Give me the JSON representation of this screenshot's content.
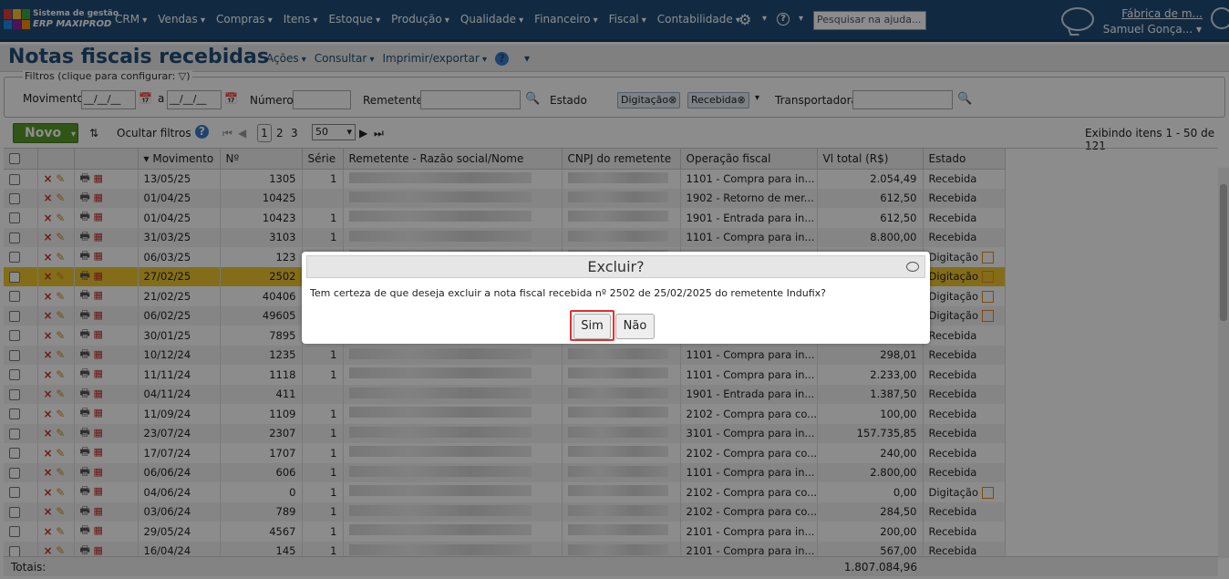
{
  "app": {
    "brand_line1": "Sistema de gestão",
    "brand_line2": "ERP MAXIPROD",
    "logo_colors": [
      "#e53935",
      "#fbc02d",
      "#43a047",
      "#1e88e5",
      "#8e24aa",
      "#fb8c00"
    ]
  },
  "topnav": {
    "items": [
      "CRM",
      "Vendas",
      "Compras",
      "Itens",
      "Estoque",
      "Produção",
      "Qualidade",
      "Financeiro",
      "Fiscal",
      "Contabilidade"
    ],
    "search_placeholder": "Pesquisar na ajuda...",
    "company": "Fábrica de m...",
    "user": "Samuel Gonça..."
  },
  "page": {
    "title": "Notas fiscais recebidas",
    "actions": [
      "Ações",
      "Consultar",
      "Imprimir/exportar"
    ],
    "help": "?"
  },
  "filters": {
    "legend": "Filtros (clique para configurar:",
    "movimento_label": "Movimento",
    "date_placeholder": "__/__/__",
    "a_label": "a",
    "numero_label": "Número",
    "remetente_label": "Remetente",
    "estado_label": "Estado",
    "estado_chips": [
      "Digitação",
      "Recebida"
    ],
    "transportadora_label": "Transportadora"
  },
  "toolbar": {
    "novo": "Novo",
    "ocultar": "Ocultar filtros",
    "pages": [
      "1",
      "2",
      "3"
    ],
    "page_size": "50",
    "exibindo": "Exibindo itens 1 - 50 de 121"
  },
  "table": {
    "headers": [
      "Movimento",
      "Nº",
      "Série",
      "Remetente - Razão social/Nome",
      "CNPJ do remetente",
      "Operação fiscal",
      "Vl total (R$)",
      "Estado"
    ],
    "rows": [
      [
        "13/05/25",
        "1305",
        "1",
        "1101 - Compra para in...",
        "2.054,49",
        "Recebida"
      ],
      [
        "01/04/25",
        "10425",
        "",
        "1902 - Retorno de mer...",
        "612,50",
        "Recebida"
      ],
      [
        "01/04/25",
        "10423",
        "1",
        "1901 - Entrada para in...",
        "612,50",
        "Recebida"
      ],
      [
        "31/03/25",
        "3103",
        "1",
        "1101 - Compra para in...",
        "8.800,00",
        "Recebida"
      ],
      [
        "06/03/25",
        "123",
        "",
        "",
        "",
        "Digitação"
      ],
      [
        "27/02/25",
        "2502",
        "",
        "",
        "",
        "Digitação"
      ],
      [
        "21/02/25",
        "40406",
        "",
        "",
        "",
        "Digitação"
      ],
      [
        "06/02/25",
        "49605",
        "",
        "",
        "",
        "Digitação"
      ],
      [
        "30/01/25",
        "7895",
        "",
        "",
        "",
        "Recebida"
      ],
      [
        "10/12/24",
        "1235",
        "1",
        "1101 - Compra para in...",
        "298,01",
        "Recebida"
      ],
      [
        "11/11/24",
        "1118",
        "1",
        "1101 - Compra para in...",
        "2.233,00",
        "Recebida"
      ],
      [
        "04/11/24",
        "411",
        "",
        "1901 - Entrada para in...",
        "1.387,50",
        "Recebida"
      ],
      [
        "11/09/24",
        "1109",
        "1",
        "2102 - Compra para co...",
        "100,00",
        "Recebida"
      ],
      [
        "23/07/24",
        "2307",
        "1",
        "3101 - Compra para in...",
        "157.735,85",
        "Recebida"
      ],
      [
        "17/07/24",
        "1707",
        "1",
        "2102 - Compra para co...",
        "240,00",
        "Recebida"
      ],
      [
        "06/06/24",
        "606",
        "1",
        "1101 - Compra para in...",
        "2.800,00",
        "Recebida"
      ],
      [
        "04/06/24",
        "0",
        "1",
        "2102 - Compra para co...",
        "0,00",
        "Digitação"
      ],
      [
        "03/06/24",
        "789",
        "1",
        "2102 - Compra para co...",
        "284,50",
        "Recebida"
      ],
      [
        "29/05/24",
        "4567",
        "1",
        "2101 - Compra para in...",
        "200,00",
        "Recebida"
      ],
      [
        "16/04/24",
        "145",
        "1",
        "2101 - Compra para in...",
        "567,00",
        "Recebida"
      ]
    ],
    "totals_label": "Totais:",
    "totals_value": "1.807.084,96"
  },
  "dialog": {
    "title": "Excluir?",
    "message": "Tem certeza de que deseja excluir a nota fiscal recebida nº 2502 de 25/02/2025 do remetente Indufix?",
    "yes": "Sim",
    "no": "Não"
  }
}
